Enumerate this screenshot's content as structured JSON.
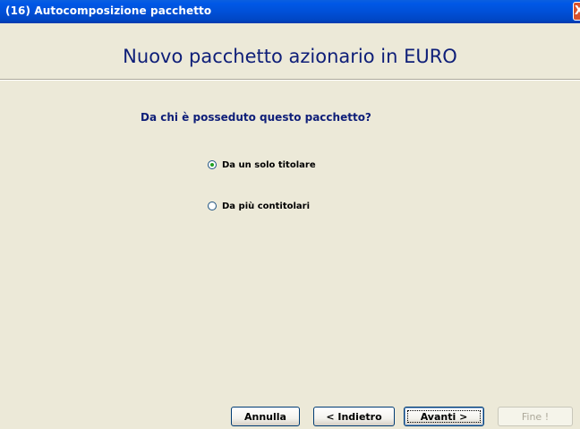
{
  "window": {
    "title": "(16) Autocomposizione pacchetto",
    "close_glyph": "X"
  },
  "header": {
    "heading": "Nuovo pacchetto azionario in EURO"
  },
  "main": {
    "question": "Da chi è posseduto questo pacchetto?",
    "options": [
      {
        "label": "Da un solo titolare",
        "selected": true
      },
      {
        "label": "Da più contitolari",
        "selected": false
      }
    ]
  },
  "footer": {
    "buttons": {
      "cancel": "Annulla",
      "back": "< Indietro",
      "next": "Avanti >",
      "finish": "Fine !"
    }
  },
  "colors": {
    "titlebar": "#0054E3",
    "heading_text": "#0E1E78",
    "dialog_bg": "#ECE9D8",
    "radio_dot": "#21A121"
  }
}
